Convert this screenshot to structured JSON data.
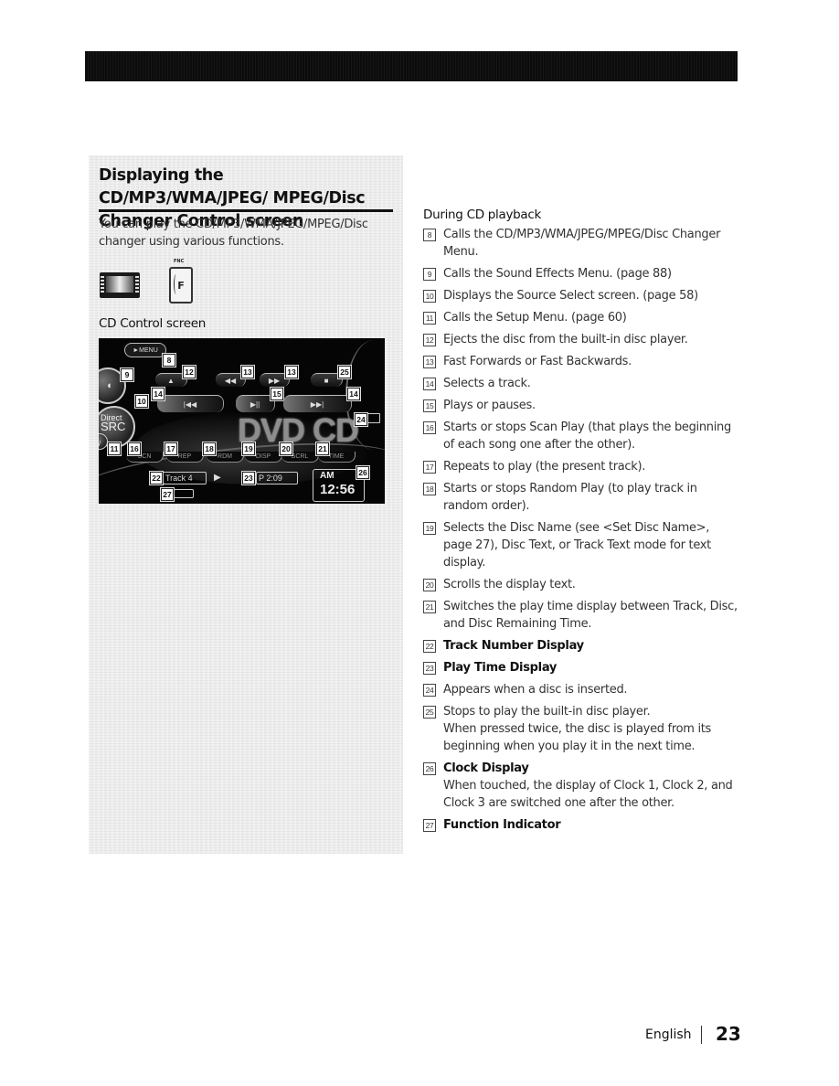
{
  "section": {
    "title": "Displaying the CD/MP3/WMA/JPEG/ MPEG/Disc Changer Control screen",
    "intro": "You can play the CD/MP3/WMA/JPEG/MPEG/Disc changer using various functions.",
    "fnc_key_label": "FNC",
    "fnc_key_glyph": "F",
    "subheading": "CD Control screen"
  },
  "screen": {
    "menu_label": "MENU",
    "direct_src_label": [
      "Direct",
      "SRC"
    ],
    "transport": {
      "eject": "▲",
      "rewind": "◀◀",
      "fast_forward": "▶▶",
      "stop": "■",
      "prev_track": "|◀◀",
      "play_pause": "▶||",
      "next_track": "▶▶|"
    },
    "source_logo": "DVD CD",
    "function_buttons": [
      "SCN",
      "REP",
      "RDM",
      "DISP",
      "SCRL",
      "TIME"
    ],
    "track_display": "Track 4",
    "play_indicator": "▶",
    "play_time": "P  2:09",
    "clock_ampm": "AM",
    "clock_time": "12:56",
    "callouts": {
      "menu": "8",
      "sound": "9",
      "src": "10",
      "setup": "11",
      "eject": "12",
      "rew": "13",
      "ff": "13",
      "stop": "25",
      "prev": "14",
      "play": "15",
      "next": "14",
      "disc": "24",
      "scn": "16",
      "rep": "17",
      "rdm": "18",
      "disp": "19",
      "scrl": "20",
      "time": "21",
      "track": "22",
      "playtime": "23",
      "clock": "26",
      "func": "27"
    }
  },
  "playback": {
    "heading": "During CD playback",
    "items": [
      {
        "num": "8",
        "text": "Calls the CD/MP3/WMA/JPEG/MPEG/Disc Changer Menu."
      },
      {
        "num": "9",
        "text": "Calls the Sound Effects Menu. (page 88)"
      },
      {
        "num": "10",
        "text": "Displays the Source Select screen. (page 58)"
      },
      {
        "num": "11",
        "text": "Calls the Setup Menu. (page 60)"
      },
      {
        "num": "12",
        "text": "Ejects the disc from the built-in disc player."
      },
      {
        "num": "13",
        "text": "Fast Forwards or Fast Backwards."
      },
      {
        "num": "14",
        "text": "Selects a track."
      },
      {
        "num": "15",
        "text": "Plays or pauses."
      },
      {
        "num": "16",
        "text": "Starts or stops Scan Play (that plays the beginning of each song one after the other)."
      },
      {
        "num": "17",
        "text": "Repeats to play (the present track)."
      },
      {
        "num": "18",
        "text": "Starts or stops Random Play (to play track in random order)."
      },
      {
        "num": "19",
        "text": "Selects the Disc Name (see <Set Disc Name>, page 27), Disc Text, or Track Text mode for text display."
      },
      {
        "num": "20",
        "text": "Scrolls the display text."
      },
      {
        "num": "21",
        "text": "Switches the play time display between Track, Disc, and Disc Remaining Time."
      },
      {
        "num": "22",
        "text": "Track Number Display",
        "bold": true
      },
      {
        "num": "23",
        "text": "Play Time Display",
        "bold": true
      },
      {
        "num": "24",
        "text": "Appears when a disc is inserted."
      },
      {
        "num": "25",
        "text": "Stops to play the built-in disc player.",
        "note": "When pressed twice, the disc is played from its beginning when you play it in the next time."
      },
      {
        "num": "26",
        "text": "Clock Display",
        "bold": true,
        "note": "When touched, the display of Clock 1, Clock 2, and Clock 3 are switched one after the other."
      },
      {
        "num": "27",
        "text": "Function Indicator",
        "bold": true
      }
    ]
  },
  "footer": {
    "language": "English",
    "page_number": "23"
  }
}
